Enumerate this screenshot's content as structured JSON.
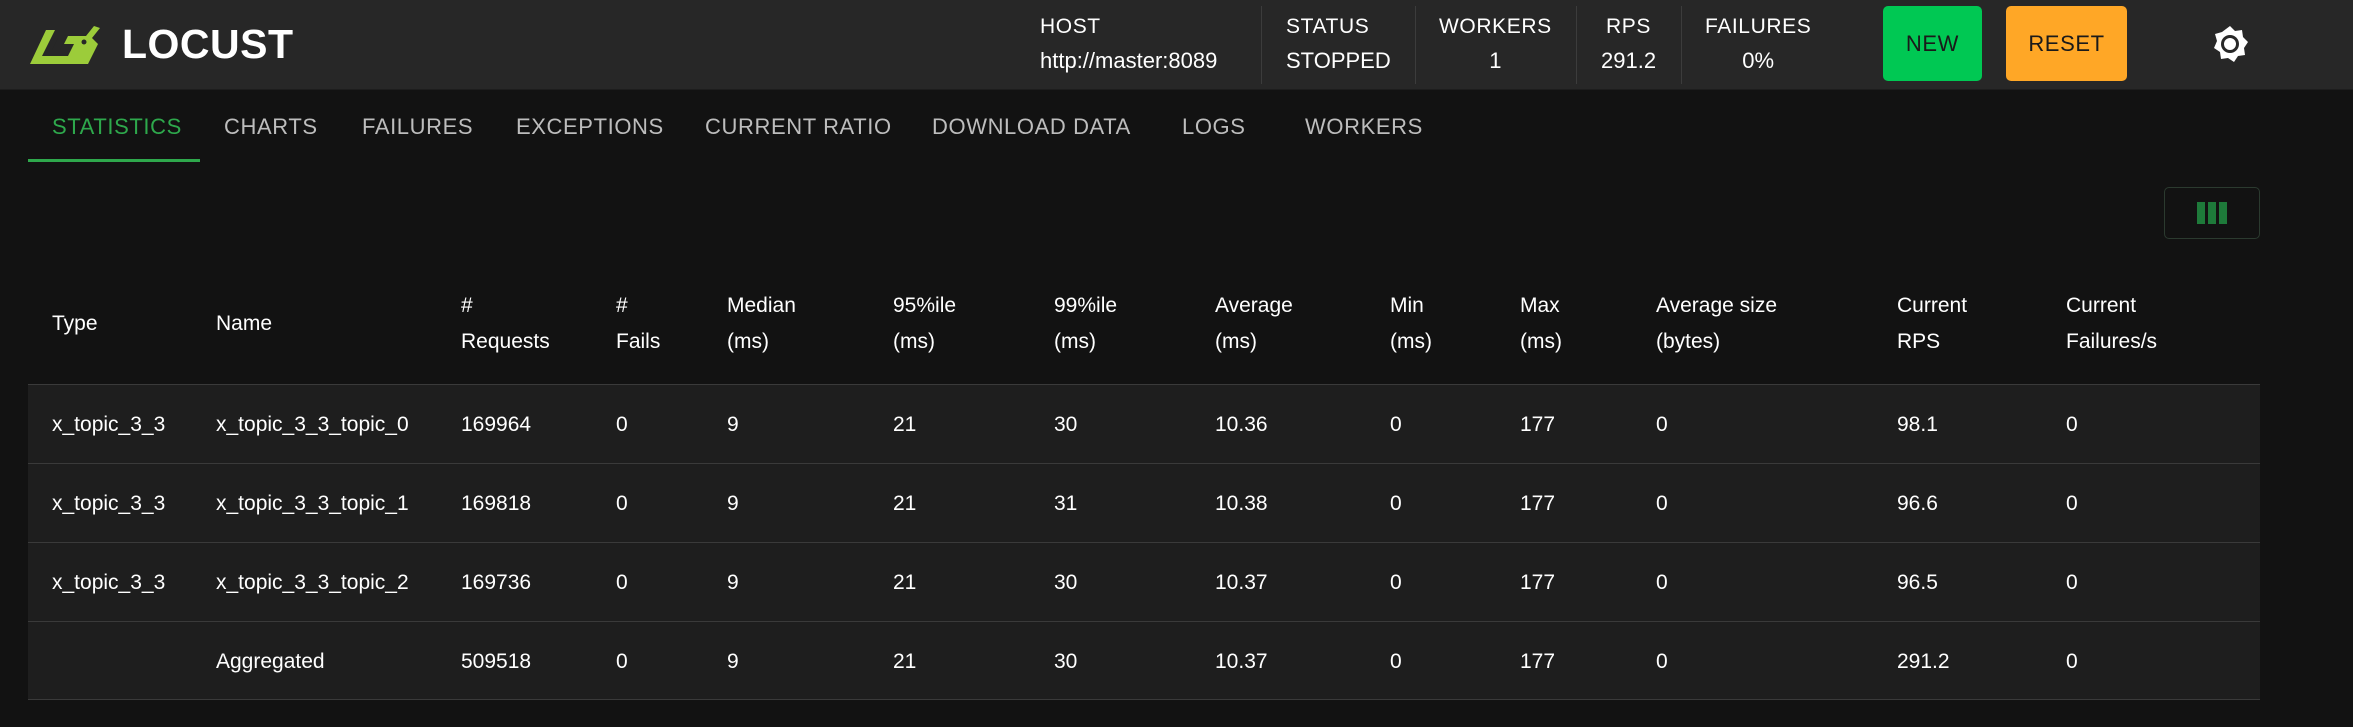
{
  "app": {
    "name": "LOCUST"
  },
  "header": {
    "host_label": "HOST",
    "host_value": "http://master:8089",
    "status_label": "STATUS",
    "status_value": "STOPPED",
    "workers_label": "WORKERS",
    "workers_value": "1",
    "rps_label": "RPS",
    "rps_value": "291.2",
    "failures_label": "FAILURES",
    "failures_value": "0%",
    "new_button": "NEW",
    "reset_button": "RESET"
  },
  "tabs": [
    {
      "label": "STATISTICS",
      "active": true
    },
    {
      "label": "CHARTS"
    },
    {
      "label": "FAILURES"
    },
    {
      "label": "EXCEPTIONS"
    },
    {
      "label": "CURRENT RATIO"
    },
    {
      "label": "DOWNLOAD DATA"
    },
    {
      "label": "LOGS"
    },
    {
      "label": "WORKERS"
    }
  ],
  "table": {
    "headers": [
      [
        "Type",
        ""
      ],
      [
        "Name",
        ""
      ],
      [
        "#",
        "Requests"
      ],
      [
        "#",
        "Fails"
      ],
      [
        "Median",
        "(ms)"
      ],
      [
        "95%ile",
        "(ms)"
      ],
      [
        "99%ile",
        "(ms)"
      ],
      [
        "Average",
        "(ms)"
      ],
      [
        "Min",
        "(ms)"
      ],
      [
        "Max",
        "(ms)"
      ],
      [
        "Average size",
        "(bytes)"
      ],
      [
        "Current",
        "RPS"
      ],
      [
        "Current",
        "Failures/s"
      ]
    ],
    "rows": [
      [
        "x_topic_3_3",
        "x_topic_3_3_topic_0",
        "169964",
        "0",
        "9",
        "21",
        "30",
        "10.36",
        "0",
        "177",
        "0",
        "98.1",
        "0"
      ],
      [
        "x_topic_3_3",
        "x_topic_3_3_topic_1",
        "169818",
        "0",
        "9",
        "21",
        "31",
        "10.38",
        "0",
        "177",
        "0",
        "96.6",
        "0"
      ],
      [
        "x_topic_3_3",
        "x_topic_3_3_topic_2",
        "169736",
        "0",
        "9",
        "21",
        "30",
        "10.37",
        "0",
        "177",
        "0",
        "96.5",
        "0"
      ],
      [
        "",
        "Aggregated",
        "509518",
        "0",
        "9",
        "21",
        "30",
        "10.37",
        "0",
        "177",
        "0",
        "291.2",
        "0"
      ]
    ]
  },
  "colors": {
    "accent_green": "#2ea84c",
    "logo_green": "#9ccc3a",
    "new_button": "#00c853",
    "reset_button": "#ffa726"
  },
  "icons": {
    "logo": "locust-logo-icon",
    "theme": "brightness-icon",
    "columns": "view-column-icon"
  }
}
